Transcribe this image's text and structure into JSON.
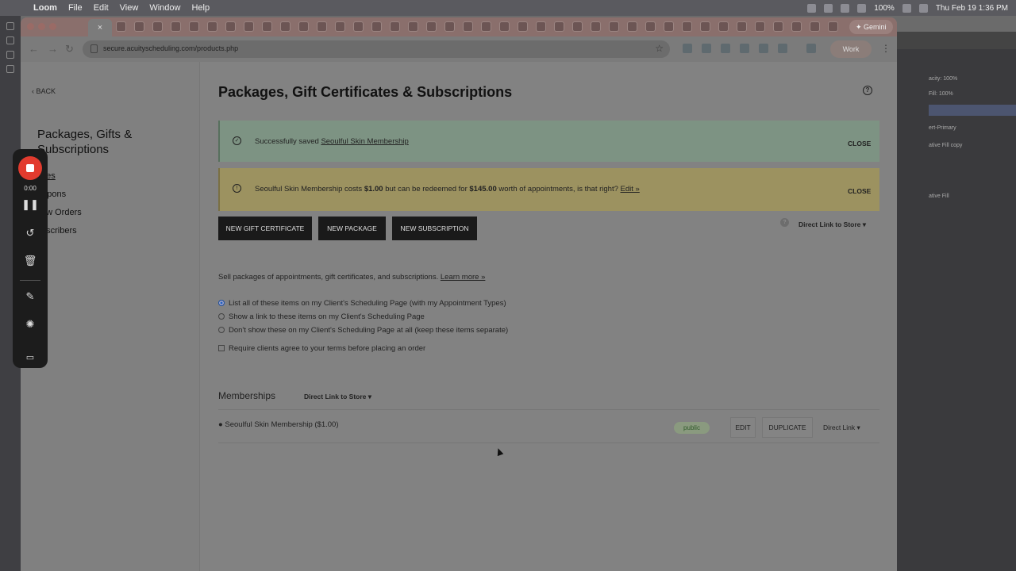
{
  "menubar": {
    "items": [
      "Loom",
      "File",
      "Edit",
      "View",
      "Window",
      "Help"
    ],
    "battery": "100%",
    "clock": "Thu Feb 19  1:36 PM"
  },
  "browser": {
    "active_tab_close": "×",
    "gemini_label": "✦ Gemini",
    "url": "secure.acuityscheduling.com/products.php",
    "work_label": "Work"
  },
  "sidebar": {
    "back_label": "BACK",
    "title": "Packages, Gifts & Subscriptions",
    "items": [
      "pes",
      "oupons",
      "ew Orders",
      "bscribers"
    ]
  },
  "main": {
    "title": "Packages, Gift Certificates & Subscriptions",
    "success_prefix": "Successfully saved ",
    "success_link": "Seoulful Skin Membership",
    "warning_p1": "Seoulful Skin Membership costs ",
    "warning_cost": "$1.00",
    "warning_p2": " but can be redeemed for ",
    "warning_value": "$145.00",
    "warning_p3": " worth of appointments, is that right? ",
    "warning_link": "Edit »",
    "close_label": "CLOSE",
    "buttons": {
      "gift": "NEW GIFT CERTIFICATE",
      "package": "NEW PACKAGE",
      "subscription": "NEW SUBSCRIPTION"
    },
    "store_link": "Direct Link to Store",
    "help_mark": "?",
    "description": "Sell packages of appointments, gift certificates, and subscriptions. ",
    "learn_more": "Learn more »",
    "options": [
      "List all of these items on my Client's Scheduling Page (with my Appointment Types)",
      "Show a link to these items on my Client's Scheduling Page",
      "Don't show these on my Client's Scheduling Page at all (keep these items separate)"
    ],
    "terms_option": "Require clients agree to your terms before placing an order",
    "section_title": "Memberships",
    "membership": {
      "name": "Seoulful Skin Membership ($1.00)",
      "status": "public",
      "edit": "EDIT",
      "duplicate": "DUPLICATE",
      "direct_link": "Direct Link"
    }
  },
  "loom": {
    "timer": "0:00"
  },
  "design_app": {
    "opacity": "acity:  100%",
    "fill": "Fill:  100%",
    "layers": [
      "ert-Primary",
      "ative Fill copy",
      "ative Fill"
    ]
  }
}
